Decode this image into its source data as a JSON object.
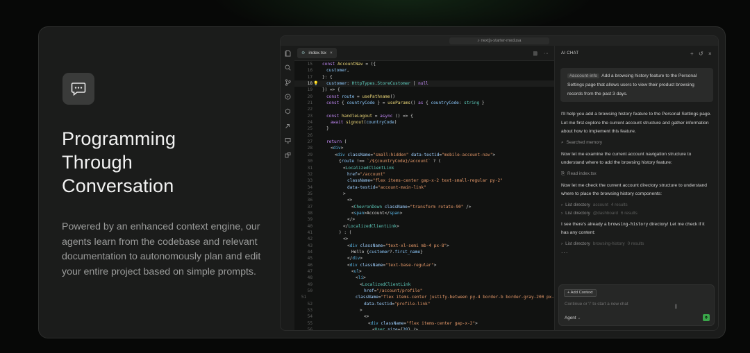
{
  "hero": {
    "headline_lines": [
      "Programming",
      "Through",
      "Conversation"
    ],
    "description": "Powered by an enhanced context engine, our agents learn from the codebase and relevant documentation to autonomously plan and edit your entire project based on simple prompts.",
    "icon": "chat-bubble-icon"
  },
  "window": {
    "title": "nextjs-starter-medusa",
    "activity_icons": [
      "files-icon",
      "search-icon",
      "source-control-icon",
      "run-debug-icon",
      "extensions-icon",
      "deploy-icon",
      "remote-icon",
      "packages-icon"
    ]
  },
  "editor": {
    "tab_label": "index.tsx",
    "active_line": 18,
    "lines": [
      {
        "n": 15,
        "indent": 0,
        "html": "<span class='kw'>const</span> <span class='fn'>AccountNav</span> = ({"
      },
      {
        "n": 16,
        "indent": 1,
        "html": "<span class='vr'>customer</span>,"
      },
      {
        "n": 17,
        "indent": 0,
        "html": "}: {"
      },
      {
        "n": 18,
        "indent": 1,
        "html": "<span class='vr'>customer</span>: <span class='tp'>HttpTypes</span>.<span class='tp'>StoreCustomer</span> | <span class='kw'>null</span>"
      },
      {
        "n": 19,
        "indent": 0,
        "html": "}) => {"
      },
      {
        "n": 20,
        "indent": 1,
        "html": "<span class='kw'>const</span> <span class='vr'>route</span> = <span class='fn'>usePathname</span>()"
      },
      {
        "n": 21,
        "indent": 1,
        "html": "<span class='kw'>const</span> { <span class='vr'>countryCode</span> } = <span class='fn'>useParams</span>() <span class='kw'>as</span> { <span class='vr'>countryCode</span>: <span class='tp'>string</span> }"
      },
      {
        "n": 22,
        "indent": 0,
        "html": ""
      },
      {
        "n": 23,
        "indent": 1,
        "html": "<span class='kw'>const</span> <span class='fn'>handleLogout</span> = <span class='kw'>async</span> () => {"
      },
      {
        "n": 24,
        "indent": 2,
        "html": "<span class='kw'>await</span> <span class='fn'>signout</span>(<span class='vr'>countryCode</span>)"
      },
      {
        "n": 25,
        "indent": 1,
        "html": "}"
      },
      {
        "n": 26,
        "indent": 0,
        "html": ""
      },
      {
        "n": 27,
        "indent": 1,
        "html": "<span class='kw'>return</span> ("
      },
      {
        "n": 28,
        "indent": 2,
        "html": "&lt;<span class='tg'>div</span>&gt;"
      },
      {
        "n": 29,
        "indent": 3,
        "html": "&lt;<span class='tg'>div</span> <span class='at'>className</span>=<span class='st'>\"small:hidden\"</span> <span class='at'>data-testid</span>=<span class='st'>\"mobile-account-nav\"</span>&gt;"
      },
      {
        "n": 30,
        "indent": 4,
        "html": "{<span class='vr'>route</span> !== <span class='st'>`/${countryCode}/account`</span> ? ("
      },
      {
        "n": 31,
        "indent": 5,
        "html": "&lt;<span class='tp'>LocalizedClientLink</span>"
      },
      {
        "n": 32,
        "indent": 6,
        "html": "<span class='at'>href</span>=<span class='st'>\"/account\"</span>"
      },
      {
        "n": 33,
        "indent": 6,
        "html": "<span class='at'>className</span>=<span class='st'>\"flex items-center gap-x-2 text-small-regular py-2\"</span>"
      },
      {
        "n": 34,
        "indent": 6,
        "html": "<span class='at'>data-testid</span>=<span class='st'>\"account-main-link\"</span>"
      },
      {
        "n": 35,
        "indent": 5,
        "html": "&gt;"
      },
      {
        "n": 36,
        "indent": 6,
        "html": "&lt;&gt;"
      },
      {
        "n": 37,
        "indent": 7,
        "html": "&lt;<span class='tp'>ChevronDown</span> <span class='at'>className</span>=<span class='st'>\"transform rotate-90\"</span> /&gt;"
      },
      {
        "n": 38,
        "indent": 7,
        "html": "&lt;<span class='tg'>span</span>&gt;Account&lt;/<span class='tg'>span</span>&gt;"
      },
      {
        "n": 39,
        "indent": 6,
        "html": "&lt;/&gt;"
      },
      {
        "n": 40,
        "indent": 5,
        "html": "&lt;/<span class='tp'>LocalizedClientLink</span>&gt;"
      },
      {
        "n": 41,
        "indent": 4,
        "html": ") : ("
      },
      {
        "n": 42,
        "indent": 5,
        "html": "&lt;&gt;"
      },
      {
        "n": 43,
        "indent": 6,
        "html": "&lt;<span class='tg'>div</span> <span class='at'>className</span>=<span class='st'>\"text-xl-semi mb-4 px-8\"</span>&gt;"
      },
      {
        "n": 44,
        "indent": 7,
        "html": "Hello {<span class='vr'>customer</span>?.<span class='vr'>first_name</span>}"
      },
      {
        "n": 45,
        "indent": 6,
        "html": "&lt;/<span class='tg'>div</span>&gt;"
      },
      {
        "n": 46,
        "indent": 6,
        "html": "&lt;<span class='tg'>div</span> <span class='at'>className</span>=<span class='st'>\"text-base-regular\"</span>&gt;"
      },
      {
        "n": 47,
        "indent": 7,
        "html": "&lt;<span class='tg'>ul</span>&gt;"
      },
      {
        "n": 48,
        "indent": 8,
        "html": "&lt;<span class='tg'>li</span>&gt;"
      },
      {
        "n": 49,
        "indent": 9,
        "html": "&lt;<span class='tp'>LocalizedClientLink</span>"
      },
      {
        "n": 50,
        "indent": 10,
        "html": "<span class='at'>href</span>=<span class='st'>\"/account/profile\"</span>"
      },
      {
        "n": 51,
        "indent": 10,
        "html": "<span class='at'>className</span>=<span class='st'>\"flex items-center justify-between py-4 border-b border-gray-200 px-</span>"
      },
      {
        "n": 52,
        "indent": 10,
        "html": "<span class='at'>data-testid</span>=<span class='st'>\"profile-link\"</span>"
      },
      {
        "n": 53,
        "indent": 9,
        "html": "&gt;"
      },
      {
        "n": 54,
        "indent": 10,
        "html": "&lt;&gt;"
      },
      {
        "n": 55,
        "indent": 11,
        "html": "&lt;<span class='tg'>div</span> <span class='at'>className</span>=<span class='st'>\"flex items-center gap-x-2\"</span>&gt;"
      },
      {
        "n": 56,
        "indent": 12,
        "html": "&lt;<span class='tp'>User</span> <span class='at'>size</span>={<span class='vr'>20</span>} /&gt;"
      },
      {
        "n": 57,
        "indent": 12,
        "html": "&lt;<span class='tg'>span</span>&gt;Profile&lt;/<span class='tg'>span</span>&gt;"
      },
      {
        "n": 58,
        "indent": 11,
        "html": "&lt;/<span class='tg'>div</span>&gt;"
      }
    ]
  },
  "chat": {
    "header_label": "AI CHAT",
    "header_actions": [
      "+",
      "↺",
      "×"
    ],
    "user_mention": "#account-info",
    "user_message": "Add a browsing history feature to the Personal Settings page that allows users to view their product browsing records from the past 3 days.",
    "reply_intro": "I'll help you add a browsing history feature to the Personal Settings page. Let me first explore the current account structure and gather information about how to implement this feature.",
    "tool_searched": "Searched memory",
    "msg_examine": "Now let me examine the current account navigation structure to understand where to add the browsing history feature:",
    "tool_read": "Read index.tsx",
    "msg_check": "Now let me check the current account directory structure to understand where to place the browsing history components:",
    "list1_label": "List directory",
    "list1_path": "account",
    "list1_count": "4 results",
    "list2_label": "List directory",
    "list2_path": "@dashboard",
    "list2_count": "6 results",
    "msg_found_pre": "I see there's already a",
    "msg_found_code": "browsing-history",
    "msg_found_post": "directory! Let me check if it has any content:",
    "list3_label": "List directory",
    "list3_path": "browsing-history",
    "list3_count": "0 results",
    "loading": "...",
    "add_context": "+ Add Context",
    "input_placeholder": "Continue or '/' to start a new chat",
    "agent_label": "Agent"
  }
}
